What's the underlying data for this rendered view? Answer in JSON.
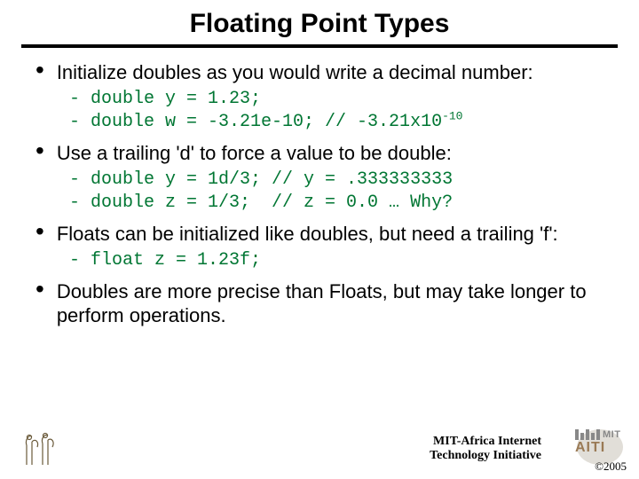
{
  "title": "Floating Point Types",
  "bullets": {
    "b1": "Initialize doubles as you would write a decimal number:",
    "b2": "Use a trailing 'd' to force a value to be double:",
    "b3": "Floats can be initialized like doubles, but need a trailing 'f':",
    "b4": "Doubles are more precise than Floats, but may take longer to perform operations."
  },
  "code": {
    "c1a": "- double y = 1.23;",
    "c1b_pre": "- double w = -3.21e-10; // -3.21x10",
    "c1b_sup": "-10",
    "c2a": "- double y = 1d/3; // y = .333333333",
    "c2b": "- double z = 1/3;  // z = 0.0 … Why?",
    "c3a": "- float z = 1.23f;"
  },
  "footer": {
    "org_line1": "MIT-Africa Internet",
    "org_line2": "Technology Initiative",
    "mit": "MIT",
    "aiti": "AITI",
    "copyright": "©2005"
  }
}
